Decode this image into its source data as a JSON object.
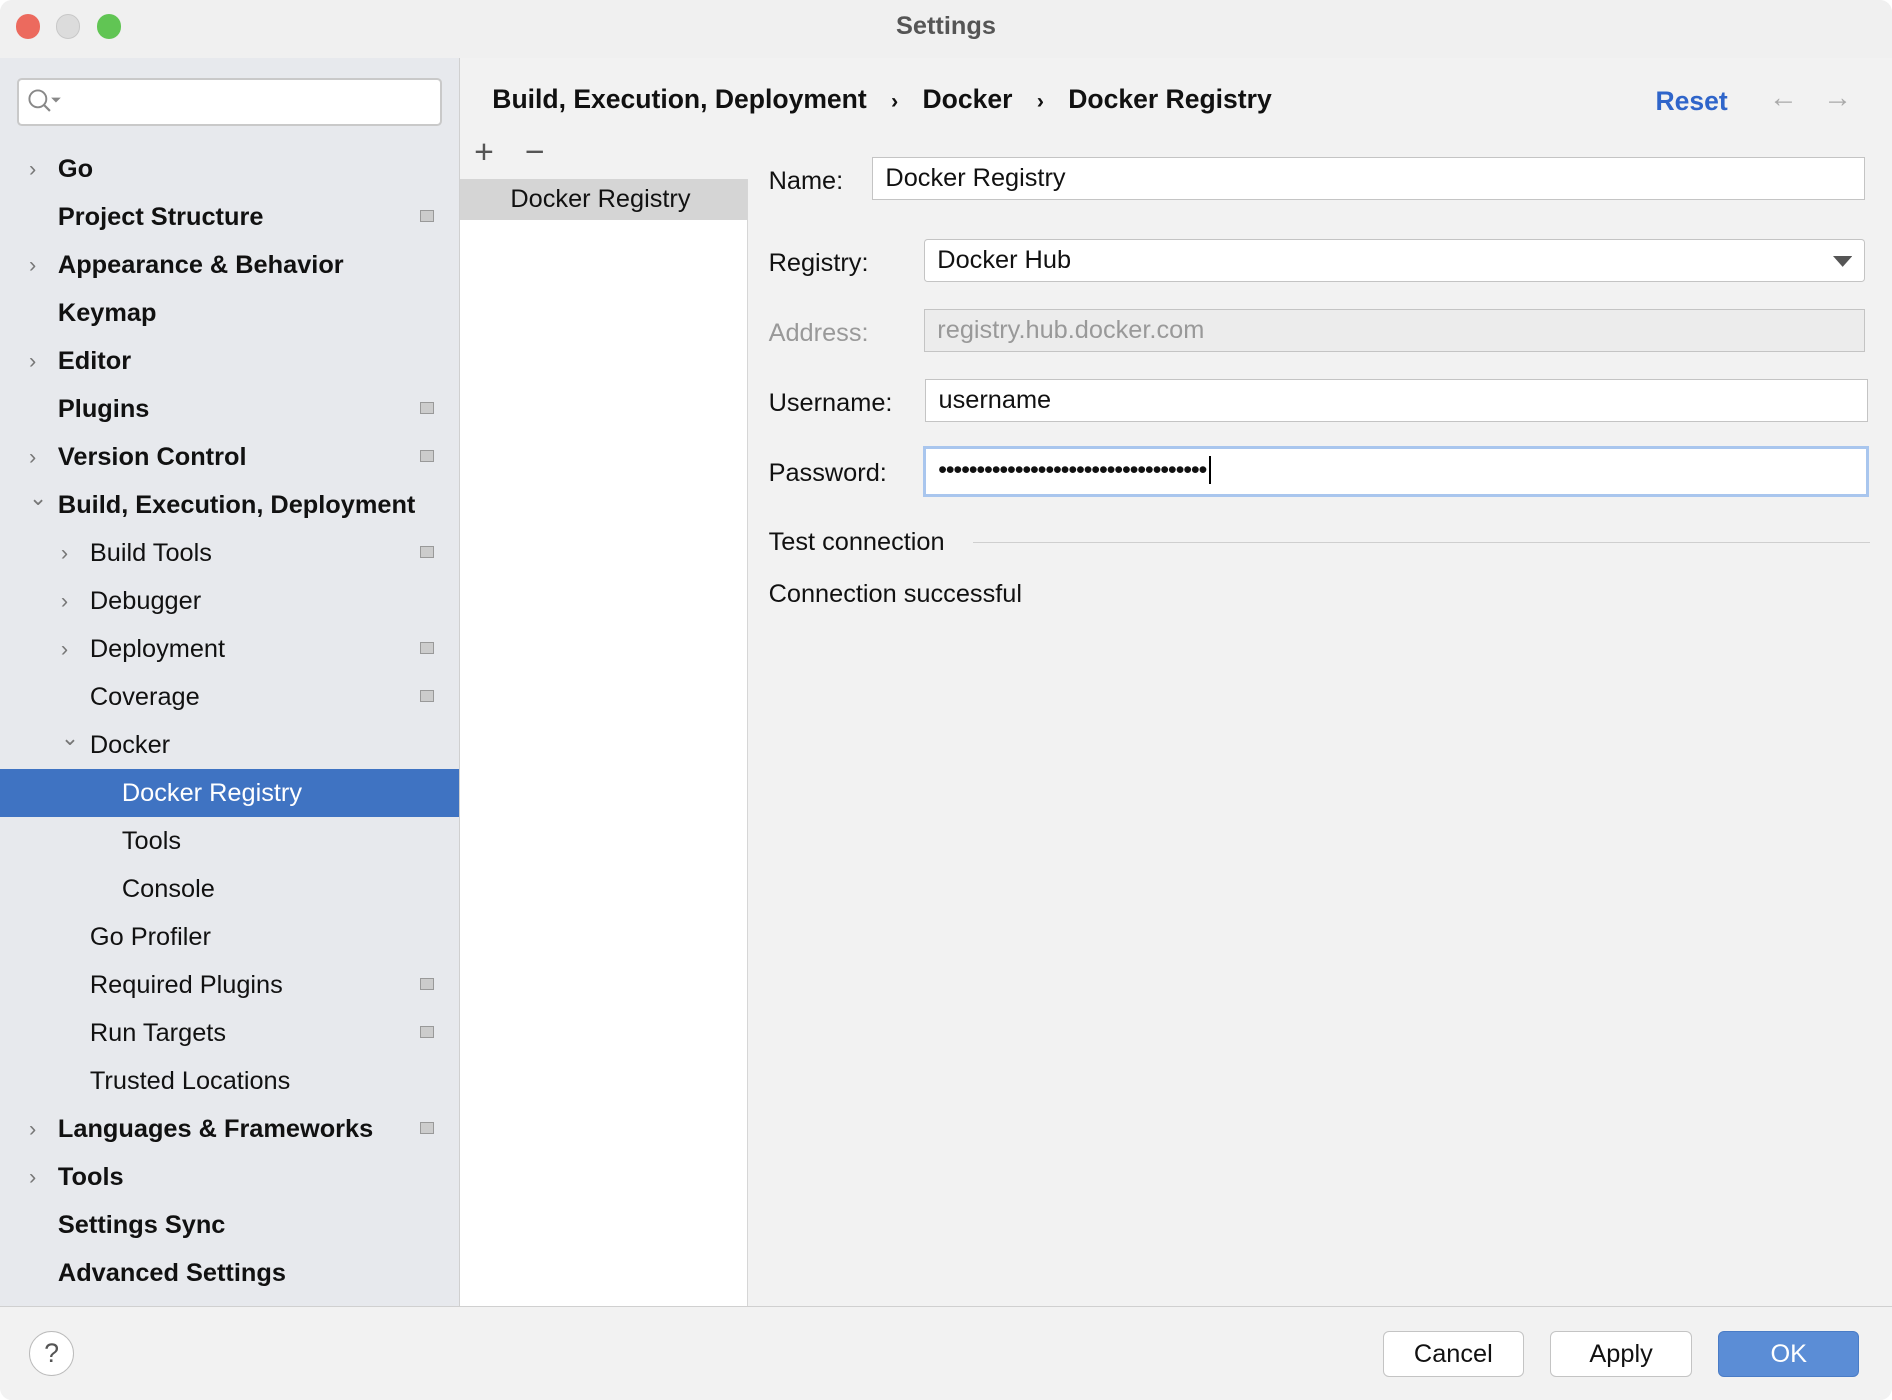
{
  "window": {
    "title": "Settings"
  },
  "sidebar": {
    "search_placeholder": "",
    "items": [
      {
        "label": "Go",
        "level": 0,
        "bold": true,
        "expander": "collapsed",
        "badge": false
      },
      {
        "label": "Project Structure",
        "level": 0,
        "bold": true,
        "expander": "none",
        "badge": true
      },
      {
        "label": "Appearance & Behavior",
        "level": 0,
        "bold": true,
        "expander": "collapsed",
        "badge": false
      },
      {
        "label": "Keymap",
        "level": 0,
        "bold": true,
        "expander": "none",
        "badge": false
      },
      {
        "label": "Editor",
        "level": 0,
        "bold": true,
        "expander": "collapsed",
        "badge": false
      },
      {
        "label": "Plugins",
        "level": 0,
        "bold": true,
        "expander": "none",
        "badge": true
      },
      {
        "label": "Version Control",
        "level": 0,
        "bold": true,
        "expander": "collapsed",
        "badge": true
      },
      {
        "label": "Build, Execution, Deployment",
        "level": 0,
        "bold": true,
        "expander": "expanded",
        "badge": false
      },
      {
        "label": "Build Tools",
        "level": 1,
        "bold": false,
        "expander": "collapsed",
        "badge": true
      },
      {
        "label": "Debugger",
        "level": 1,
        "bold": false,
        "expander": "collapsed",
        "badge": false
      },
      {
        "label": "Deployment",
        "level": 1,
        "bold": false,
        "expander": "collapsed",
        "badge": true
      },
      {
        "label": "Coverage",
        "level": 1,
        "bold": false,
        "expander": "none",
        "badge": true
      },
      {
        "label": "Docker",
        "level": 1,
        "bold": false,
        "expander": "expanded",
        "badge": false
      },
      {
        "label": "Docker Registry",
        "level": 2,
        "bold": false,
        "expander": "none",
        "badge": false,
        "selected": true
      },
      {
        "label": "Tools",
        "level": 2,
        "bold": false,
        "expander": "none",
        "badge": false
      },
      {
        "label": "Console",
        "level": 2,
        "bold": false,
        "expander": "none",
        "badge": false
      },
      {
        "label": "Go Profiler",
        "level": 1,
        "bold": false,
        "expander": "none",
        "badge": false
      },
      {
        "label": "Required Plugins",
        "level": 1,
        "bold": false,
        "expander": "none",
        "badge": true
      },
      {
        "label": "Run Targets",
        "level": 1,
        "bold": false,
        "expander": "none",
        "badge": true
      },
      {
        "label": "Trusted Locations",
        "level": 1,
        "bold": false,
        "expander": "none",
        "badge": false
      },
      {
        "label": "Languages & Frameworks",
        "level": 0,
        "bold": true,
        "expander": "collapsed",
        "badge": true
      },
      {
        "label": "Tools",
        "level": 0,
        "bold": true,
        "expander": "collapsed",
        "badge": false
      },
      {
        "label": "Settings Sync",
        "level": 0,
        "bold": true,
        "expander": "none",
        "badge": false
      },
      {
        "label": "Advanced Settings",
        "level": 0,
        "bold": true,
        "expander": "none",
        "badge": false
      }
    ]
  },
  "breadcrumb": [
    "Build, Execution, Deployment",
    "Docker",
    "Docker Registry"
  ],
  "header": {
    "reset_label": "Reset"
  },
  "list": {
    "add": "+",
    "remove": "−",
    "items": [
      "Docker Registry"
    ]
  },
  "form": {
    "name_label": "Name:",
    "name_value": "Docker Registry",
    "registry_label": "Registry:",
    "registry_value": "Docker Hub",
    "address_label": "Address:",
    "address_value": "registry.hub.docker.com",
    "username_label": "Username:",
    "username_value": "username",
    "password_label": "Password:",
    "password_value": "•••••••••••••••••••••••••••••••••••",
    "test_label": "Test connection",
    "status": "Connection successful"
  },
  "footer": {
    "help": "?",
    "cancel": "Cancel",
    "apply": "Apply",
    "ok": "OK"
  },
  "colors": {
    "accent": "#3f73c2",
    "link": "#2f65ca"
  }
}
